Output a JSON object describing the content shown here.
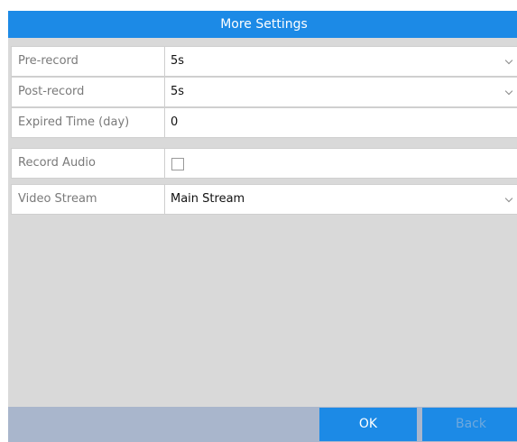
{
  "dialog": {
    "title": "More Settings"
  },
  "fields": {
    "pre_record": {
      "label": "Pre-record",
      "value": "5s"
    },
    "post_record": {
      "label": "Post-record",
      "value": "5s"
    },
    "expired_time": {
      "label": "Expired Time (day)",
      "value": "0"
    },
    "record_audio": {
      "label": "Record Audio",
      "checked": false
    },
    "video_stream": {
      "label": "Video Stream",
      "value": "Main Stream"
    }
  },
  "buttons": {
    "ok_label": "OK",
    "back_label": "Back"
  },
  "icons": {
    "dropdown": "chevron-down-icon",
    "checkbox": "checkbox-unchecked"
  },
  "colors": {
    "accent": "#1c8ae6",
    "footer": "#a9b6cc",
    "panel": "#d9d9d9"
  }
}
